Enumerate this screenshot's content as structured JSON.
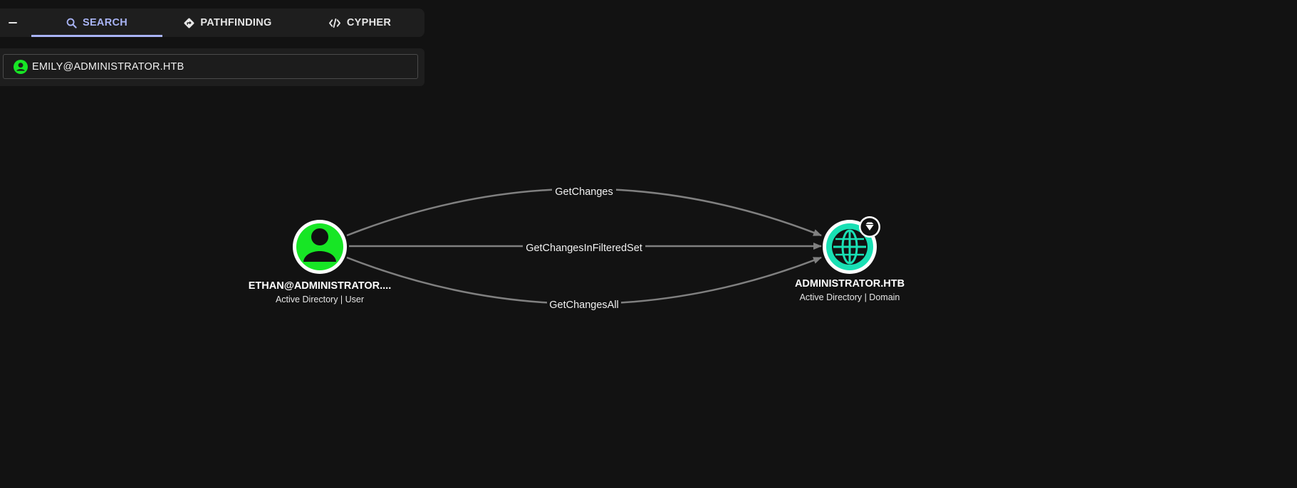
{
  "tabs": [
    {
      "label": "SEARCH",
      "icon": "search-icon",
      "active": true
    },
    {
      "label": "PATHFINDING",
      "icon": "pathfinding-icon",
      "active": false
    },
    {
      "label": "CYPHER",
      "icon": "code-icon",
      "active": false
    }
  ],
  "search": {
    "value": "EMILY@ADMINISTRATOR.HTB",
    "icon": "user-icon",
    "icon_color": "#17e625"
  },
  "graph": {
    "source": {
      "label": "ETHAN@ADMINISTRATOR....",
      "subtitle": "Active Directory | User",
      "icon": "user-icon",
      "color": "#17e625"
    },
    "target": {
      "label": "ADMINISTRATOR.HTB",
      "subtitle": "Active Directory | Domain",
      "icon": "globe-icon",
      "badge_icon": "gem-icon",
      "color": "#19e0b4"
    },
    "edges": [
      {
        "label": "GetChanges"
      },
      {
        "label": "GetChangesInFilteredSet"
      },
      {
        "label": "GetChangesAll"
      }
    ]
  },
  "colors": {
    "background": "#121212",
    "panel": "#1e1e1e",
    "accent": "#a9b4f5",
    "edge": "#808080"
  }
}
